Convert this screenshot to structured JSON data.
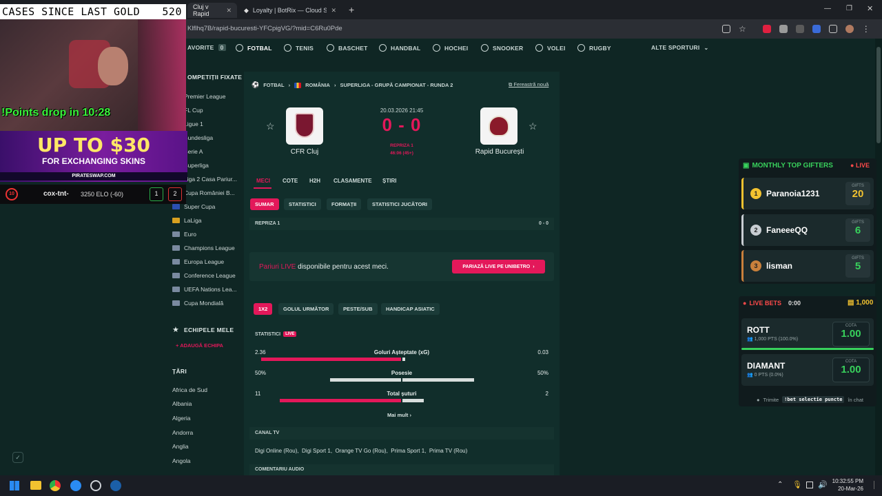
{
  "browser": {
    "tabs": [
      {
        "label": "Cluj v Rapid",
        "active": true
      },
      {
        "label": "Loyalty | BotRix — Cloud Strea",
        "active": false
      }
    ],
    "new_tab": "+",
    "url": "Klflhq7B/rapid-bucuresti-YFCpigVG/?mid=C6Ru0Pde"
  },
  "sport_nav": {
    "items": [
      {
        "label": "AVORITE",
        "badge": "0"
      },
      {
        "label": "FOTBAL"
      },
      {
        "label": "TENIS"
      },
      {
        "label": "BASCHET"
      },
      {
        "label": "HANDBAL"
      },
      {
        "label": "HOCHEI"
      },
      {
        "label": "SNOOKER"
      },
      {
        "label": "VOLEI"
      },
      {
        "label": "RUGBY"
      }
    ],
    "more": "ALTE SPORTURI"
  },
  "sidebar": {
    "competitions_title": "OMPETIȚII FIXATE",
    "competitions": [
      "Premier League",
      "FL Cup",
      "Ligue 1",
      "Bundesliga",
      "Serie A",
      "Superliga",
      "Liga 2 Casa Pariur...",
      "Cupa României B...",
      "Super Cupa",
      "LaLiga",
      "Euro",
      "Champions League",
      "Europa League",
      "Conference League",
      "UEFA Nations Lea...",
      "Cupa Mondială"
    ],
    "teams_title": "ECHIPELE MELE",
    "add_team": "ADAUGĂ ECHIPA",
    "countries_title": "ȚĂRI",
    "countries": [
      "Africa de Sud",
      "Albania",
      "Algeria",
      "Andorra",
      "Anglia",
      "Angola"
    ]
  },
  "match": {
    "breadcrumb": [
      "FOTBAL",
      "ROMÂNIA",
      "SUPERLIGA - GRUPĂ CAMPIONAT - RUNDA 2"
    ],
    "new_window": "Fereastră nouă",
    "datetime": "20.03.2026 21:45",
    "score": "0 - 0",
    "status": "REPRIZA 1",
    "minute": "46:06 (45+)",
    "home": "CFR Cluj",
    "away": "Rapid București",
    "tabs": [
      "MECI",
      "COTE",
      "H2H",
      "CLASAMENTE",
      "ȘTIRI"
    ],
    "subtabs": [
      "SUMAR",
      "STATISTICI",
      "FORMAȚII",
      "STATISTICI JUCĂTORI"
    ],
    "half_label": "REPRIZA 1",
    "half_score": "0 - 0",
    "live_promo_prefix": "Pariuri LIVE",
    "live_promo_text": "disponibile pentru acest meci.",
    "live_button": "PARIAZĂ LIVE PE UNIBETRO",
    "odds_tabs": [
      "1X2",
      "GOLUL URMĂTOR",
      "PESTE/SUB",
      "HANDICAP ASIATIC"
    ],
    "stats_title": "STATISTICI",
    "live_badge": "LIVE",
    "stats": [
      {
        "label": "Goluri Așteptate (xG)",
        "home": "2.36",
        "away": "0.03",
        "home_share": 0.98
      },
      {
        "label": "Posesie",
        "home": "50%",
        "away": "50%",
        "home_share": 0.5
      },
      {
        "label": "Total șuturi",
        "home": "11",
        "away": "2",
        "home_share": 0.85
      }
    ],
    "more": "Mai mult",
    "tv_title": "CANAL TV",
    "tv_channels": "Digi Online (Rou),  Digi Sport 1,  Orange TV Go (Rou),  Prima Sport 1,  Prima TV (Rou)",
    "audio_title": "COMENTARIU AUDIO"
  },
  "overlay": {
    "cases_label": "CASES SINCE LAST GOLD",
    "cases_count": "520",
    "points_drop": "!Points drop in 10:28",
    "promo_big": "UP TO $30",
    "promo_small": "FOR EXCHANGING SKINS",
    "promo_site": "PIRATESWAP.COM",
    "elo_level": "10",
    "elo_name": "cox-tnt-",
    "elo_value": "3250 ELO (-60)",
    "elo_w": "1",
    "elo_l": "2"
  },
  "gifters": {
    "title": "MONTHLY TOP GIFTERS",
    "live": "LIVE",
    "gifts_label": "GIFTS",
    "rows": [
      {
        "rank": "1",
        "name": "Paranoia1231",
        "gifts": "20",
        "color": "#f2c230"
      },
      {
        "rank": "2",
        "name": "FaneeeQQ",
        "gifts": "6",
        "color": "#c8cdd2"
      },
      {
        "rank": "3",
        "name": "lisman",
        "gifts": "5",
        "color": "#c9803c"
      }
    ]
  },
  "livebets": {
    "title": "LIVE BETS",
    "timer": "0:00",
    "coins": "1,000",
    "cota_label": "COTA",
    "rows": [
      {
        "name": "ROTT",
        "pts": "1,000 PTS",
        "pct": "(100.0%)",
        "cota": "1.00",
        "share": 1.0
      },
      {
        "name": "DIAMANT",
        "pts": "0 PTS",
        "pct": "(0.0%)",
        "cota": "1.00",
        "share": 0.0
      }
    ],
    "footer_prefix": "Trimite",
    "footer_cmd": "!bet selectie puncte",
    "footer_suffix": "în chat"
  },
  "taskbar": {
    "time": "10:32:55 PM",
    "date": "20-Mar-26"
  },
  "colors": {
    "accent_red": "#e3185a",
    "bg": "#0f2624",
    "panel": "#112e2b",
    "gift_green": "#38d15c"
  }
}
